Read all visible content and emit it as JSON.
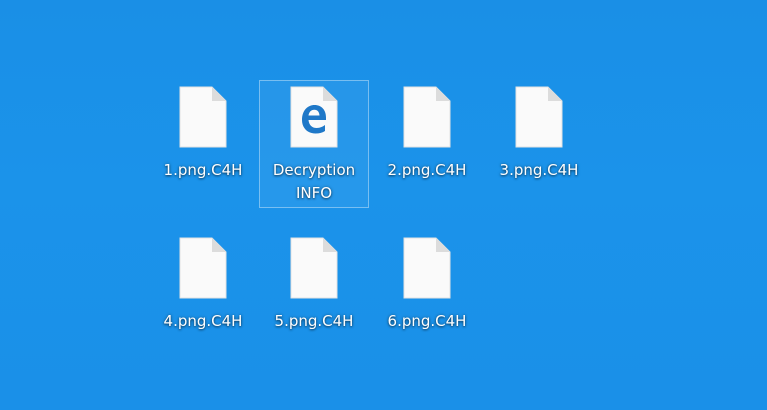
{
  "desktop": {
    "background_color": "#1a8fe6",
    "icons": [
      {
        "label": "1.png.C4H",
        "icon": "blank-file-icon"
      },
      {
        "label_line1": "Decryption",
        "label_line2": "INFO",
        "icon": "edge-html-file-icon",
        "selected": true
      },
      {
        "label": "2.png.C4H",
        "icon": "blank-file-icon"
      },
      {
        "label": "3.png.C4H",
        "icon": "blank-file-icon"
      },
      {
        "label": "4.png.C4H",
        "icon": "blank-file-icon"
      },
      {
        "label": "5.png.C4H",
        "icon": "blank-file-icon"
      },
      {
        "label": "6.png.C4H",
        "icon": "blank-file-icon"
      }
    ],
    "colors": {
      "file_fill": "#fafafa",
      "file_fold": "#dcdcdc",
      "edge_blue": "#1f78c8",
      "label_text": "#ffffff"
    }
  }
}
